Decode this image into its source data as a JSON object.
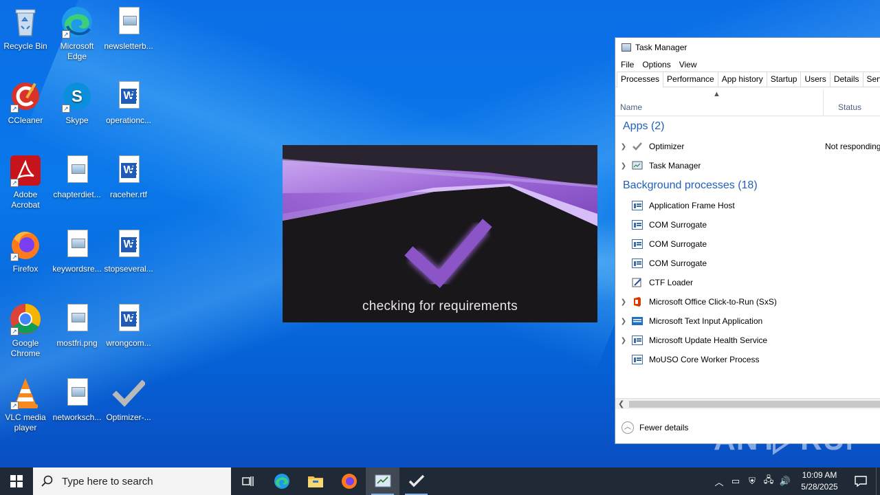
{
  "desktop": {
    "icons": [
      {
        "label": "Recycle Bin"
      },
      {
        "label": "Microsoft Edge"
      },
      {
        "label": "newsletterb..."
      },
      {
        "label": "CCleaner"
      },
      {
        "label": "Skype"
      },
      {
        "label": "operationc..."
      },
      {
        "label": "Adobe Acrobat"
      },
      {
        "label": "chapterdiet..."
      },
      {
        "label": "raceher.rtf"
      },
      {
        "label": "Firefox"
      },
      {
        "label": "keywordsre..."
      },
      {
        "label": "stopseveral..."
      },
      {
        "label": "Google Chrome"
      },
      {
        "label": "mostfri.png"
      },
      {
        "label": "wrongcom..."
      },
      {
        "label": "VLC media player"
      },
      {
        "label": "networksch..."
      },
      {
        "label": "Optimizer-..."
      }
    ]
  },
  "splash": {
    "status_text": "checking for requirements",
    "accent_color": "#8b55c8"
  },
  "task_manager": {
    "title": "Task Manager",
    "menu": [
      "File",
      "Options",
      "View"
    ],
    "tabs": [
      "Processes",
      "Performance",
      "App history",
      "Startup",
      "Users",
      "Details",
      "Servi"
    ],
    "columns": {
      "name": "Name",
      "status": "Status"
    },
    "apps_group": "Apps (2)",
    "apps": [
      {
        "name": "Optimizer",
        "status": "Not responding"
      },
      {
        "name": "Task Manager",
        "status": ""
      }
    ],
    "bg_group": "Background processes (18)",
    "background": [
      {
        "name": "Application Frame Host"
      },
      {
        "name": "COM Surrogate"
      },
      {
        "name": "COM Surrogate"
      },
      {
        "name": "COM Surrogate"
      },
      {
        "name": "CTF Loader"
      },
      {
        "name": "Microsoft Office Click-to-Run (SxS)"
      },
      {
        "name": "Microsoft Text Input Application"
      },
      {
        "name": "Microsoft Update Health Service"
      },
      {
        "name": "MoUSO Core Worker Process"
      }
    ],
    "footer": "Fewer details"
  },
  "watermark": "ANY RUN",
  "taskbar": {
    "search_placeholder": "Type here to search",
    "time": "10:09 AM",
    "date": "5/28/2025"
  }
}
